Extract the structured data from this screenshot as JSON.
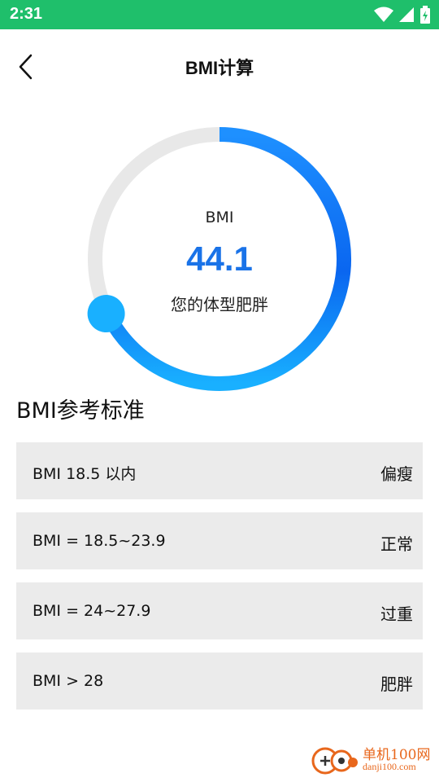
{
  "status_bar": {
    "time": "2:31"
  },
  "header": {
    "title": "BMI计算"
  },
  "gauge": {
    "label": "BMI",
    "value": "44.1",
    "status_text": "您的体型肥胖",
    "track_color": "#e8e8e8",
    "arc_gradient": [
      "#1e90ff",
      "#0a66f0",
      "#19b0ff"
    ],
    "value_color": "#1a73e8"
  },
  "reference": {
    "title": "BMI参考标准",
    "rows": [
      {
        "range": "BMI 18.5 以内",
        "category": "偏瘦"
      },
      {
        "range": "BMI = 18.5~23.9",
        "category": "正常"
      },
      {
        "range": "BMI = 24~27.9",
        "category": "过重"
      },
      {
        "range": "BMI > 28",
        "category": "肥胖"
      }
    ]
  },
  "watermark": {
    "name": "单机100网",
    "url": "danji100.com"
  },
  "colors": {
    "status_bar": "#1fbf6b",
    "row_bg": "#ebebeb"
  }
}
